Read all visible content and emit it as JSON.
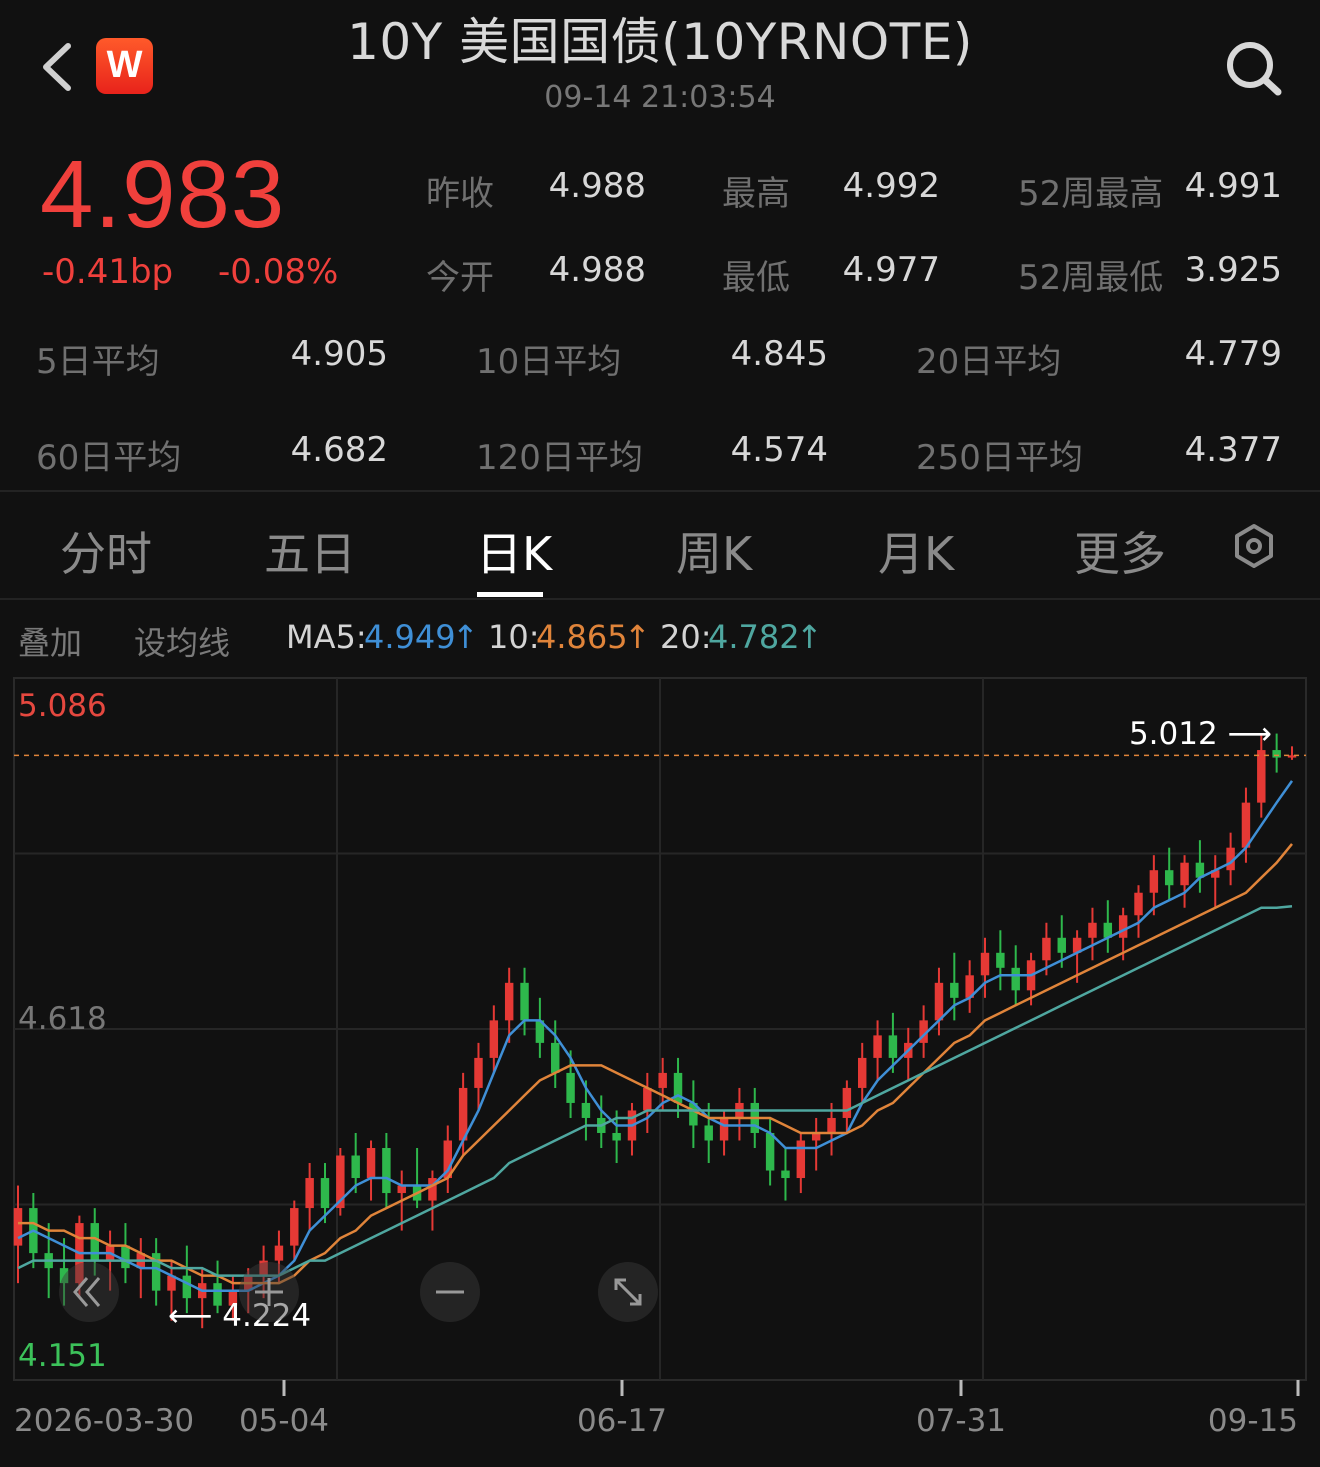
{
  "header": {
    "title": "10Y 美国国债(10YRNOTE)",
    "time": "09-14 21:03:54",
    "logo_text": "W",
    "back_icon": "chevron-left-icon",
    "search_icon": "search-icon"
  },
  "quote": {
    "price": "4.983",
    "change_bp": "-0.41bp",
    "change_pct": "-0.08%",
    "color_down": "#f0403c"
  },
  "stats": [
    {
      "label": "昨收",
      "value": "4.988"
    },
    {
      "label": "最高",
      "value": "4.992"
    },
    {
      "label": "52周最高",
      "value": "4.991"
    },
    {
      "label": "今开",
      "value": "4.988"
    },
    {
      "label": "最低",
      "value": "4.977"
    },
    {
      "label": "52周最低",
      "value": "3.925"
    }
  ],
  "averages": [
    {
      "label": "5日平均",
      "value": "4.905"
    },
    {
      "label": "10日平均",
      "value": "4.845"
    },
    {
      "label": "20日平均",
      "value": "4.779"
    },
    {
      "label": "60日平均",
      "value": "4.682"
    },
    {
      "label": "120日平均",
      "value": "4.574"
    },
    {
      "label": "250日平均",
      "value": "4.377"
    }
  ],
  "tabs": [
    {
      "label": "分时"
    },
    {
      "label": "五日"
    },
    {
      "label": "日K"
    },
    {
      "label": "周K"
    },
    {
      "label": "月K"
    },
    {
      "label": "更多"
    }
  ],
  "active_tab": "日K",
  "toolbar": {
    "overlay": "叠加",
    "set_ma": "设均线",
    "ma5_label": "MA5:",
    "ma5_value": "4.949",
    "ma10_label": "10:",
    "ma10_value": "4.865",
    "ma20_label": "20:",
    "ma20_value": "4.782",
    "arrow": "↑"
  },
  "colors": {
    "up": "#e53935",
    "down": "#2eb84c",
    "ma5": "#3f8fd6",
    "ma10": "#e0843a",
    "ma20": "#4fa7a0"
  },
  "chart_data": {
    "type": "candlestick",
    "y_high_label": "5.086",
    "y_mid_label": "4.618",
    "y_low_label": "4.151",
    "ylim": [
      4.151,
      5.086
    ],
    "x_tick_labels": [
      "2026-03-30",
      "05-04",
      "06-17",
      "07-31",
      "09-15"
    ],
    "max_marker": {
      "label": "5.012",
      "arrow": "⟶"
    },
    "min_marker": {
      "label": "4.224",
      "arrow": "⟵"
    },
    "current_line": 4.983,
    "series": [
      {
        "name": "K",
        "ohlc": [
          [
            4.33,
            4.41,
            4.28,
            4.38
          ],
          [
            4.38,
            4.4,
            4.3,
            4.32
          ],
          [
            4.32,
            4.36,
            4.26,
            4.3
          ],
          [
            4.3,
            4.34,
            4.25,
            4.28
          ],
          [
            4.28,
            4.37,
            4.26,
            4.36
          ],
          [
            4.36,
            4.38,
            4.29,
            4.31
          ],
          [
            4.31,
            4.35,
            4.27,
            4.33
          ],
          [
            4.33,
            4.36,
            4.28,
            4.3
          ],
          [
            4.3,
            4.34,
            4.26,
            4.32
          ],
          [
            4.32,
            4.34,
            4.25,
            4.27
          ],
          [
            4.27,
            4.31,
            4.23,
            4.29
          ],
          [
            4.29,
            4.33,
            4.24,
            4.26
          ],
          [
            4.26,
            4.3,
            4.22,
            4.28
          ],
          [
            4.28,
            4.31,
            4.24,
            4.25
          ],
          [
            4.25,
            4.29,
            4.23,
            4.27
          ],
          [
            4.27,
            4.3,
            4.24,
            4.29
          ],
          [
            4.29,
            4.33,
            4.26,
            4.31
          ],
          [
            4.31,
            4.35,
            4.28,
            4.33
          ],
          [
            4.33,
            4.39,
            4.31,
            4.38
          ],
          [
            4.38,
            4.44,
            4.35,
            4.42
          ],
          [
            4.42,
            4.44,
            4.36,
            4.38
          ],
          [
            4.38,
            4.46,
            4.37,
            4.45
          ],
          [
            4.45,
            4.48,
            4.4,
            4.42
          ],
          [
            4.42,
            4.47,
            4.39,
            4.46
          ],
          [
            4.46,
            4.48,
            4.38,
            4.4
          ],
          [
            4.4,
            4.43,
            4.35,
            4.41
          ],
          [
            4.41,
            4.46,
            4.38,
            4.39
          ],
          [
            4.39,
            4.43,
            4.35,
            4.42
          ],
          [
            4.42,
            4.49,
            4.4,
            4.47
          ],
          [
            4.47,
            4.56,
            4.45,
            4.54
          ],
          [
            4.54,
            4.6,
            4.51,
            4.58
          ],
          [
            4.58,
            4.65,
            4.56,
            4.63
          ],
          [
            4.63,
            4.7,
            4.6,
            4.68
          ],
          [
            4.68,
            4.7,
            4.61,
            4.63
          ],
          [
            4.63,
            4.66,
            4.58,
            4.6
          ],
          [
            4.6,
            4.63,
            4.54,
            4.56
          ],
          [
            4.56,
            4.59,
            4.5,
            4.52
          ],
          [
            4.52,
            4.55,
            4.47,
            4.5
          ],
          [
            4.5,
            4.53,
            4.46,
            4.48
          ],
          [
            4.48,
            4.51,
            4.44,
            4.47
          ],
          [
            4.47,
            4.52,
            4.45,
            4.51
          ],
          [
            4.51,
            4.56,
            4.48,
            4.54
          ],
          [
            4.54,
            4.58,
            4.51,
            4.56
          ],
          [
            4.56,
            4.58,
            4.5,
            4.52
          ],
          [
            4.52,
            4.55,
            4.46,
            4.49
          ],
          [
            4.49,
            4.52,
            4.44,
            4.47
          ],
          [
            4.47,
            4.51,
            4.45,
            4.5
          ],
          [
            4.5,
            4.54,
            4.47,
            4.52
          ],
          [
            4.52,
            4.54,
            4.46,
            4.48
          ],
          [
            4.48,
            4.5,
            4.41,
            4.43
          ],
          [
            4.43,
            4.46,
            4.39,
            4.42
          ],
          [
            4.42,
            4.48,
            4.4,
            4.47
          ],
          [
            4.47,
            4.5,
            4.43,
            4.48
          ],
          [
            4.48,
            4.52,
            4.45,
            4.5
          ],
          [
            4.5,
            4.55,
            4.48,
            4.54
          ],
          [
            4.54,
            4.6,
            4.52,
            4.58
          ],
          [
            4.58,
            4.63,
            4.55,
            4.61
          ],
          [
            4.61,
            4.64,
            4.56,
            4.58
          ],
          [
            4.58,
            4.62,
            4.55,
            4.6
          ],
          [
            4.6,
            4.65,
            4.58,
            4.63
          ],
          [
            4.63,
            4.7,
            4.61,
            4.68
          ],
          [
            4.68,
            4.72,
            4.63,
            4.66
          ],
          [
            4.66,
            4.71,
            4.64,
            4.69
          ],
          [
            4.69,
            4.74,
            4.66,
            4.72
          ],
          [
            4.72,
            4.75,
            4.67,
            4.7
          ],
          [
            4.7,
            4.73,
            4.65,
            4.67
          ],
          [
            4.67,
            4.72,
            4.65,
            4.71
          ],
          [
            4.71,
            4.76,
            4.69,
            4.74
          ],
          [
            4.74,
            4.77,
            4.7,
            4.72
          ],
          [
            4.72,
            4.75,
            4.68,
            4.74
          ],
          [
            4.74,
            4.78,
            4.71,
            4.76
          ],
          [
            4.76,
            4.79,
            4.72,
            4.74
          ],
          [
            4.74,
            4.78,
            4.71,
            4.77
          ],
          [
            4.77,
            4.81,
            4.74,
            4.8
          ],
          [
            4.8,
            4.85,
            4.77,
            4.83
          ],
          [
            4.83,
            4.86,
            4.79,
            4.81
          ],
          [
            4.81,
            4.85,
            4.78,
            4.84
          ],
          [
            4.84,
            4.87,
            4.8,
            4.82
          ],
          [
            4.82,
            4.85,
            4.78,
            4.83
          ],
          [
            4.83,
            4.88,
            4.81,
            4.86
          ],
          [
            4.86,
            4.94,
            4.84,
            4.92
          ],
          [
            4.92,
            5.01,
            4.9,
            4.99
          ],
          [
            4.99,
            5.012,
            4.96,
            4.98
          ],
          [
            4.98,
            4.995,
            4.977,
            4.983
          ]
        ]
      },
      {
        "name": "MA5",
        "values": [
          4.34,
          4.35,
          4.34,
          4.33,
          4.32,
          4.32,
          4.32,
          4.31,
          4.3,
          4.3,
          4.29,
          4.28,
          4.27,
          4.27,
          4.27,
          4.27,
          4.28,
          4.29,
          4.31,
          4.35,
          4.37,
          4.39,
          4.41,
          4.42,
          4.42,
          4.41,
          4.41,
          4.41,
          4.43,
          4.47,
          4.51,
          4.56,
          4.61,
          4.63,
          4.63,
          4.61,
          4.58,
          4.54,
          4.51,
          4.49,
          4.49,
          4.5,
          4.52,
          4.53,
          4.52,
          4.5,
          4.49,
          4.49,
          4.49,
          4.48,
          4.46,
          4.46,
          4.46,
          4.47,
          4.48,
          4.52,
          4.55,
          4.57,
          4.59,
          4.61,
          4.63,
          4.65,
          4.66,
          4.68,
          4.69,
          4.69,
          4.69,
          4.7,
          4.71,
          4.72,
          4.73,
          4.74,
          4.75,
          4.76,
          4.78,
          4.79,
          4.8,
          4.82,
          4.83,
          4.84,
          4.86,
          4.89,
          4.92,
          4.949
        ]
      },
      {
        "name": "MA10",
        "values": [
          4.36,
          4.36,
          4.35,
          4.35,
          4.34,
          4.34,
          4.33,
          4.33,
          4.32,
          4.31,
          4.31,
          4.3,
          4.29,
          4.29,
          4.28,
          4.28,
          4.28,
          4.28,
          4.29,
          4.31,
          4.32,
          4.34,
          4.35,
          4.37,
          4.38,
          4.39,
          4.4,
          4.41,
          4.42,
          4.45,
          4.47,
          4.49,
          4.51,
          4.53,
          4.55,
          4.56,
          4.57,
          4.57,
          4.57,
          4.56,
          4.55,
          4.54,
          4.53,
          4.52,
          4.51,
          4.5,
          4.5,
          4.5,
          4.5,
          4.5,
          4.49,
          4.48,
          4.48,
          4.48,
          4.48,
          4.49,
          4.51,
          4.52,
          4.54,
          4.56,
          4.58,
          4.6,
          4.61,
          4.63,
          4.64,
          4.65,
          4.66,
          4.67,
          4.68,
          4.69,
          4.7,
          4.71,
          4.72,
          4.73,
          4.74,
          4.75,
          4.76,
          4.77,
          4.78,
          4.79,
          4.8,
          4.82,
          4.84,
          4.865
        ]
      },
      {
        "name": "MA20",
        "values": [
          4.3,
          4.31,
          4.31,
          4.31,
          4.31,
          4.31,
          4.31,
          4.31,
          4.31,
          4.31,
          4.3,
          4.3,
          4.3,
          4.29,
          4.29,
          4.29,
          4.29,
          4.29,
          4.3,
          4.31,
          4.31,
          4.32,
          4.33,
          4.34,
          4.35,
          4.36,
          4.37,
          4.38,
          4.39,
          4.4,
          4.41,
          4.42,
          4.44,
          4.45,
          4.46,
          4.47,
          4.48,
          4.49,
          4.49,
          4.5,
          4.5,
          4.51,
          4.51,
          4.51,
          4.51,
          4.51,
          4.51,
          4.51,
          4.51,
          4.51,
          4.51,
          4.51,
          4.51,
          4.51,
          4.51,
          4.52,
          4.53,
          4.54,
          4.55,
          4.56,
          4.57,
          4.58,
          4.59,
          4.6,
          4.61,
          4.62,
          4.63,
          4.64,
          4.65,
          4.66,
          4.67,
          4.68,
          4.69,
          4.7,
          4.71,
          4.72,
          4.73,
          4.74,
          4.75,
          4.76,
          4.77,
          4.78,
          4.78,
          4.782
        ]
      }
    ]
  }
}
